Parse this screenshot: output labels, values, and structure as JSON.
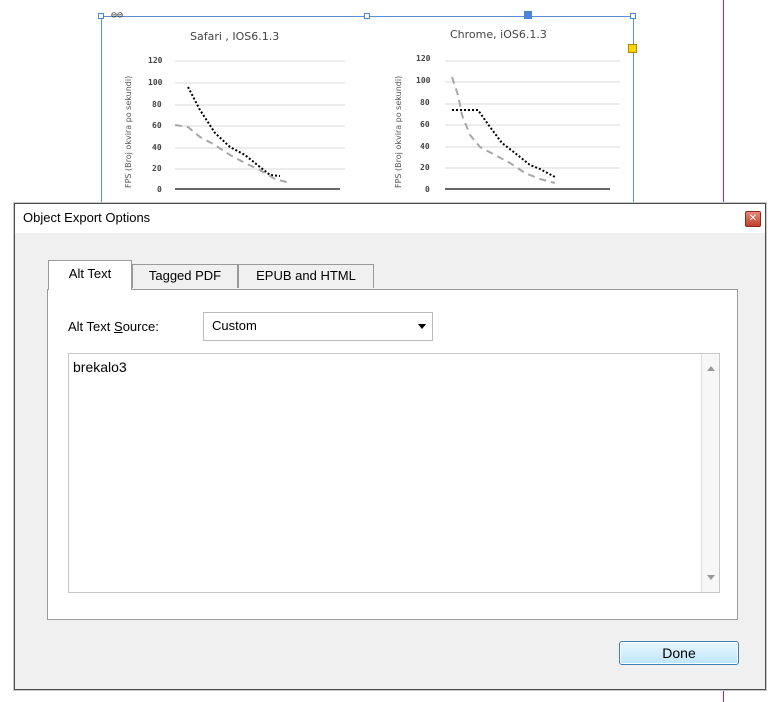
{
  "background": {
    "charts": [
      {
        "title": "Safari , IOS6.1.3",
        "ylabel": "FPS (Broj okvira po sekundi)",
        "yticks": [
          "120",
          "100",
          "80",
          "60",
          "40",
          "20",
          "0"
        ]
      },
      {
        "title": "Chrome, iOS6.1.3",
        "ylabel": "FPS (Broj okvira po sekundi)",
        "yticks": [
          "120",
          "100",
          "80",
          "60",
          "40",
          "20",
          "0"
        ]
      }
    ],
    "colors": {
      "frame": "#5a8fd8",
      "guide": "#a020f0",
      "anchor": "#ffd200"
    }
  },
  "dialog": {
    "title": "Object Export Options",
    "close_icon": "close-icon",
    "tabs": [
      {
        "label": "Alt Text",
        "active": true
      },
      {
        "label": "Tagged PDF",
        "active": false
      },
      {
        "label": "EPUB and HTML",
        "active": false
      }
    ],
    "alt_text_source_label_pre": "Alt Text ",
    "alt_text_source_label_u": "S",
    "alt_text_source_label_post": "ource:",
    "alt_text_source_value": "Custom",
    "alt_text_value": "brekalo3",
    "done_label": "Done"
  }
}
